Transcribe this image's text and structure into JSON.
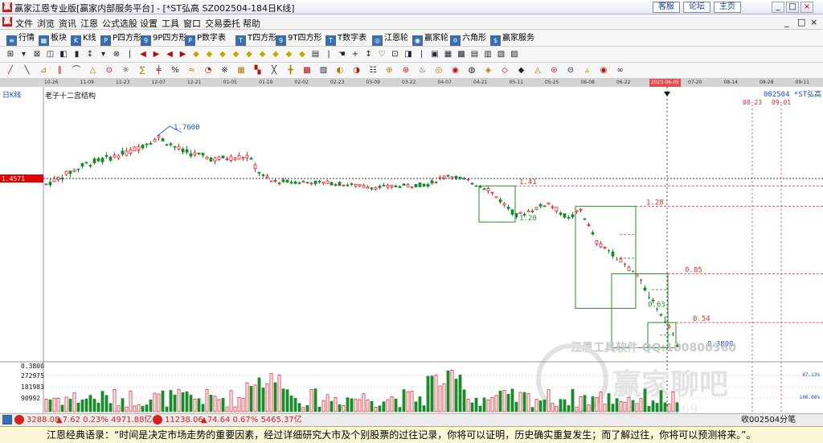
{
  "window": {
    "title": "赢家江恩专业版[赢家内部服务平台] - [*ST弘高  SZ002504-184日K线]",
    "logo_char": "赢",
    "buttons": [
      "客服",
      "论坛",
      "主页"
    ],
    "controls": [
      "_",
      "□",
      "×"
    ]
  },
  "menu": {
    "items": [
      "文件",
      "浏览",
      "资讯",
      "江恩",
      "公式选股",
      "设置",
      "工具",
      "窗口",
      "交易委托",
      "帮助"
    ],
    "mdi_controls": [
      "_",
      "□",
      "×"
    ]
  },
  "toolbar1": {
    "items": [
      {
        "label": "行情",
        "icon": "grid-icon",
        "code": "≡"
      },
      {
        "label": "板块",
        "icon": "blocks-icon",
        "code": "▦"
      },
      {
        "label": "K线",
        "icon": "candles-icon",
        "code": "K"
      },
      {
        "label": "P四方形",
        "icon": "p-square-icon",
        "code": "P"
      },
      {
        "label": "9P四方形",
        "icon": "9p-square-icon",
        "code": "9"
      },
      {
        "label": "P数字表",
        "icon": "p-table-icon",
        "code": "P"
      },
      {
        "label": "T四方形",
        "icon": "t-square-icon",
        "code": "T"
      },
      {
        "label": "9T四方形",
        "icon": "9t-square-icon",
        "code": "9"
      },
      {
        "label": "T数字表",
        "icon": "t-table-icon",
        "code": "T"
      },
      {
        "label": "江恩轮",
        "icon": "gann-wheel-icon",
        "code": "◎"
      },
      {
        "label": "赢家轮",
        "icon": "winner-wheel-icon",
        "code": "◉"
      },
      {
        "label": "六角形",
        "icon": "hexagon-icon",
        "code": "✡"
      },
      {
        "label": "赢家服务",
        "icon": "dollar-icon",
        "code": "$"
      }
    ]
  },
  "date_axis": {
    "ticks": [
      "10-26",
      "11-09",
      "11-23",
      "12-07",
      "12-21",
      "01-05",
      "01-19",
      "02-02",
      "02-23",
      "03-09",
      "03-22",
      "04-07",
      "04-21",
      "05-11",
      "05-25",
      "06-08",
      "06-22",
      "07-06",
      "07-20",
      "08-14",
      "08-28",
      "09-11"
    ],
    "highlight": "2023-06-05"
  },
  "chart_labels": {
    "period": "日K线",
    "study_name": "老子十二宫结构",
    "stock_label": "002504  *ST弘高",
    "future_dates": [
      "08-23",
      "09-01"
    ],
    "current_price_tag": "1.4571",
    "volume_axis": [
      "0.3800",
      "272975",
      "181983",
      "90992"
    ],
    "volume_right": [
      "87.13%",
      "100.00%"
    ],
    "watermark_1": "江恩工具软件  QQ:100800360",
    "watermark_2": "赢家聊吧",
    "watermark_3": "liaoba.vip369"
  },
  "chart_data": {
    "type": "candlestick",
    "ylim": [
      0.3,
      2.0
    ],
    "price_annotations": [
      {
        "text": "1.7600",
        "price": 1.76
      },
      {
        "text": "1.41",
        "price": 1.41
      },
      {
        "text": "1.20",
        "price": 1.18
      },
      {
        "text": "1.28",
        "price": 1.28
      },
      {
        "text": "0.85",
        "price": 0.85
      },
      {
        "text": "0.63",
        "price": 0.63
      },
      {
        "text": "0.54",
        "price": 0.54
      },
      {
        "text": "0.3800",
        "price": 0.38
      }
    ],
    "boxes": [
      {
        "start": 108,
        "end": 117,
        "low": 1.18,
        "high": 1.41
      },
      {
        "start": 132,
        "end": 147,
        "low": 0.63,
        "high": 1.28
      },
      {
        "start": 141,
        "end": 155,
        "low": 0.38,
        "high": 0.85
      },
      {
        "start": 150,
        "end": 157,
        "low": 0.38,
        "high": 0.54
      }
    ],
    "guides": [
      {
        "price": 1.41,
        "from": 117
      },
      {
        "price": 1.28,
        "from": 147
      },
      {
        "price": 0.85,
        "from": 155
      },
      {
        "price": 0.54,
        "from": 157
      }
    ],
    "candles_count": 158,
    "index_last": 157
  },
  "status": {
    "index1": "3288.08",
    "index1_change": "▲7.62 0.23% 4971.88亿",
    "index2": "11238.06",
    "index2_change": "▲74.64 0.67% 5465.37亿",
    "right_text": "收002504分笔"
  },
  "quote": {
    "text": "江恩经典语录：“时间是决定市场走势的重要因素，经过详细研究大市及个别股票的过往记录，你将可以证明，历史确实重复发生；而了解过往，你将可以预测将来。”。"
  },
  "colors": {
    "up": "#e0242c",
    "down": "#1a8a2b",
    "box": "#2b8a2b",
    "guide": "#d62c2c",
    "price_tag": "#e20000"
  }
}
